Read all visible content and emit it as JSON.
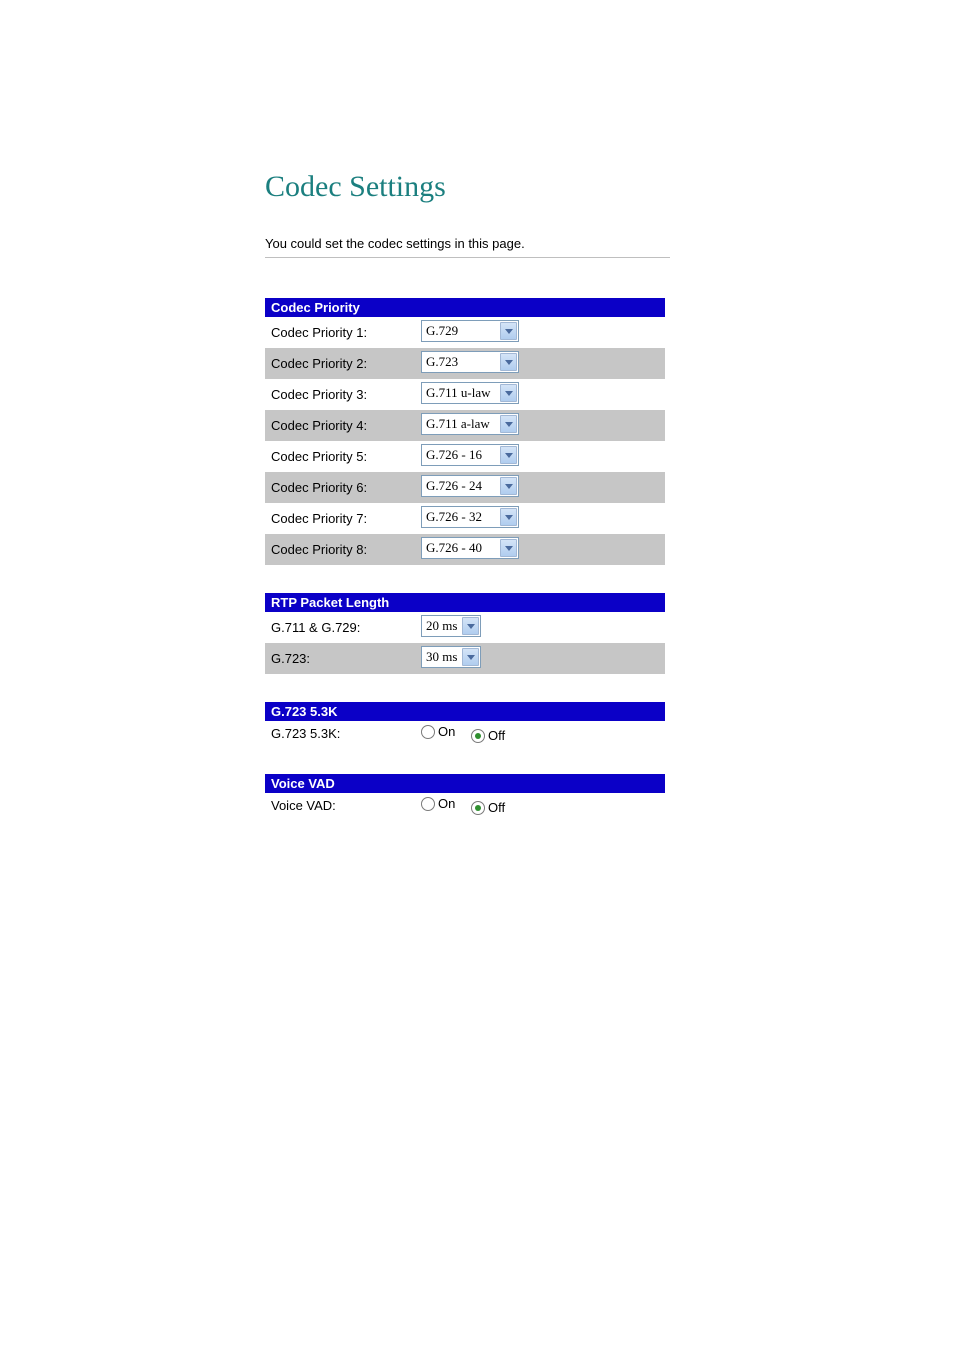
{
  "heading": "Codec Settings",
  "subtitle": "You could set the codec settings in this page.",
  "sections": {
    "codec_priority": {
      "header": "Codec Priority",
      "rows": [
        {
          "label": "Codec Priority 1:",
          "value": "G.729"
        },
        {
          "label": "Codec Priority 2:",
          "value": "G.723"
        },
        {
          "label": "Codec Priority 3:",
          "value": "G.711 u-law"
        },
        {
          "label": "Codec Priority 4:",
          "value": "G.711 a-law"
        },
        {
          "label": "Codec Priority 5:",
          "value": "G.726 - 16"
        },
        {
          "label": "Codec Priority 6:",
          "value": "G.726 - 24"
        },
        {
          "label": "Codec Priority 7:",
          "value": "G.726 - 32"
        },
        {
          "label": "Codec Priority 8:",
          "value": "G.726 - 40"
        }
      ]
    },
    "rtp": {
      "header": "RTP Packet Length",
      "rows": [
        {
          "label": "G.711 & G.729:",
          "value": "20 ms"
        },
        {
          "label": "G.723:",
          "value": "30 ms"
        }
      ]
    },
    "g723": {
      "header": "G.723 5.3K",
      "label": "G.723 5.3K:",
      "on_label": "On",
      "off_label": "Off",
      "selected": "off"
    },
    "voice_vad": {
      "header": "Voice VAD",
      "label": "Voice VAD:",
      "on_label": "On",
      "off_label": "Off",
      "selected": "off"
    }
  }
}
